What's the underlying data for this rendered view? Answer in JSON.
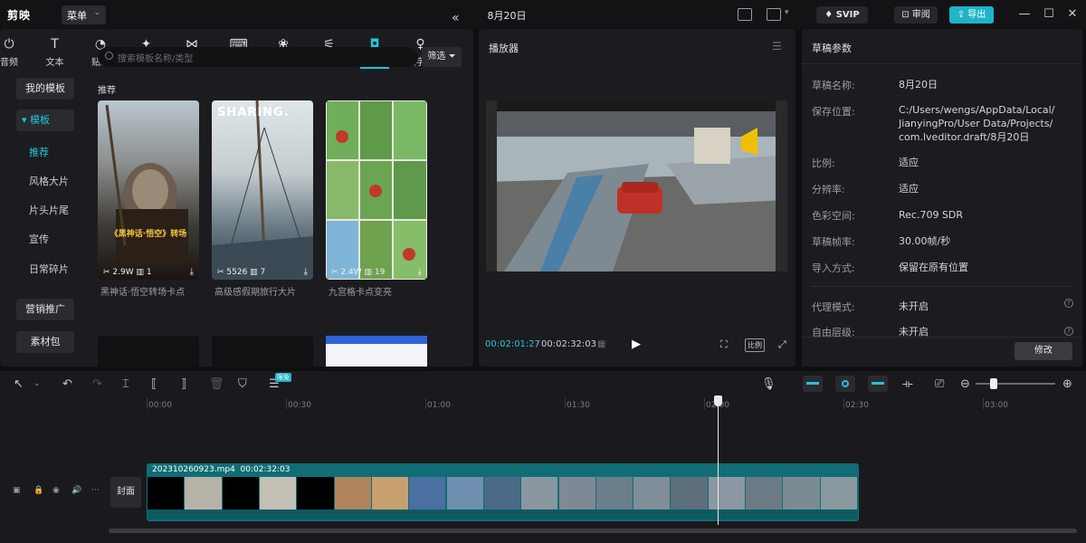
{
  "titlebar": {
    "app_name": "剪映",
    "menu_label": "菜单",
    "title": "8月20日",
    "svip_label": "SVIP",
    "review_label": "审阅",
    "export_label": "导出"
  },
  "toolbar": {
    "items": [
      {
        "label": "音频",
        "icon": "audio-icon"
      },
      {
        "label": "文本",
        "icon": "text-icon"
      },
      {
        "label": "贴纸",
        "icon": "sticker-icon"
      },
      {
        "label": "特效",
        "icon": "effects-icon"
      },
      {
        "label": "转场",
        "icon": "transition-icon"
      },
      {
        "label": "字幕",
        "icon": "subtitle-icon"
      },
      {
        "label": "滤镜",
        "icon": "filter-icon"
      },
      {
        "label": "调节",
        "icon": "adjust-icon"
      },
      {
        "label": "模板",
        "icon": "template-icon",
        "active": true
      },
      {
        "label": "数字人",
        "icon": "digital-human-icon"
      }
    ]
  },
  "sidebar": {
    "my_templates": "我的模板",
    "category": "▾ 模板",
    "items": [
      "推荐",
      "风格大片",
      "片头片尾",
      "宣传",
      "日常碎片"
    ],
    "marketing": "营销推广",
    "material_pack": "素材包"
  },
  "library": {
    "search_placeholder": "搜索模板名称/类型",
    "filter_label": "筛选",
    "section_title": "推荐",
    "templates": [
      {
        "caption": "黑神话·悟空转场卡点",
        "uses": "2.9W",
        "clips": "1",
        "overlay": "《黑神话·悟空》转场"
      },
      {
        "caption": "高级感假期旅行大片",
        "uses": "5526",
        "clips": "7",
        "overlay": "SHARING."
      },
      {
        "caption": "九宫格卡点变亮",
        "uses": "2.4W",
        "clips": "19",
        "overlay": ""
      }
    ]
  },
  "player": {
    "title": "播放器",
    "current_time": "00:02:01:27",
    "total_time": "00:02:32:03",
    "ratio_label": "比例"
  },
  "properties": {
    "title": "草稿参数",
    "rows": [
      {
        "key": "草稿名称:",
        "value": "8月20日"
      },
      {
        "key": "保存位置:",
        "value": "C:/Users/wengs/AppData/Local/JianyingPro/User Data/Projects/com.lveditor.draft/8月20日"
      },
      {
        "key": "比例:",
        "value": "适应"
      },
      {
        "key": "分辨率:",
        "value": "适应"
      },
      {
        "key": "色彩空间:",
        "value": "Rec.709 SDR"
      },
      {
        "key": "草稿帧率:",
        "value": "30.00帧/秒"
      },
      {
        "key": "导入方式:",
        "value": "保留在原有位置"
      },
      {
        "key": "代理模式:",
        "value": "未开启"
      },
      {
        "key": "自由层级:",
        "value": "未开启"
      }
    ],
    "modify_label": "修改"
  },
  "timeline": {
    "badge": "限免",
    "ruler": [
      "00:00",
      "00:30",
      "01:00",
      "01:30",
      "02:00",
      "02:30",
      "03:00"
    ],
    "clip_name": "202310260923.mp4",
    "clip_duration": "00:02:32:03",
    "cover_label": "封面",
    "playhead_fraction": 0.803
  },
  "colors": {
    "accent": "#22c4d8",
    "export_bg": "#1fb4c8",
    "track": "#106d75"
  }
}
